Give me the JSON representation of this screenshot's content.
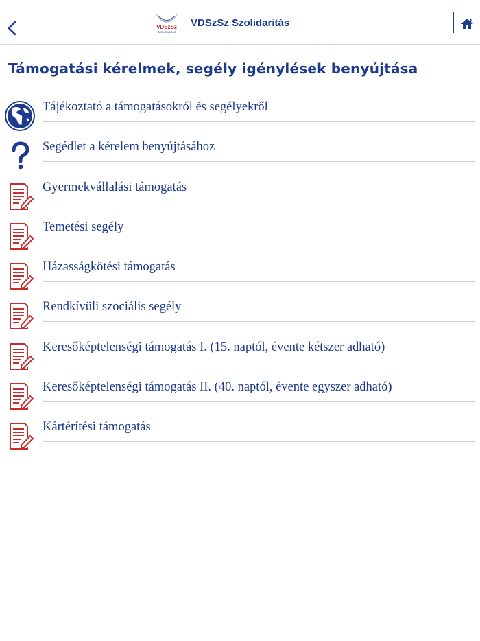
{
  "header": {
    "title": "VDSzSz Szolidaritás",
    "logo_text": "VDSzSz",
    "logo_subtext": "SZOLIDARITÁS"
  },
  "page": {
    "title": "Támogatási kérelmek, segély igénylések benyújtása"
  },
  "menu": [
    {
      "label": "Tájékoztató a támogatásokról és segélyekről",
      "icon": "globe-icon"
    },
    {
      "label": "Segédlet a kérelem benyújtásához",
      "icon": "question-icon"
    },
    {
      "label": "Gyermekvállalási támogatás",
      "icon": "form-icon"
    },
    {
      "label": "Temetési segély",
      "icon": "form-icon"
    },
    {
      "label": "Házasságkötési támogatás",
      "icon": "form-icon"
    },
    {
      "label": "Rendkívüli szociális segély",
      "icon": "form-icon"
    },
    {
      "label": "Keresőképtelenségi támogatás I. (15. naptól, évente kétszer adható)",
      "icon": "form-icon"
    },
    {
      "label": "Keresőképtelenségi támogatás II. (40. naptól, évente egyszer adható)",
      "icon": "form-icon"
    },
    {
      "label": "Kártérítési támogatás",
      "icon": "form-icon"
    }
  ],
  "colors": {
    "primary": "#1d3b8c",
    "form_icon": "#c62d2d",
    "separator": "#cfcfcf"
  }
}
